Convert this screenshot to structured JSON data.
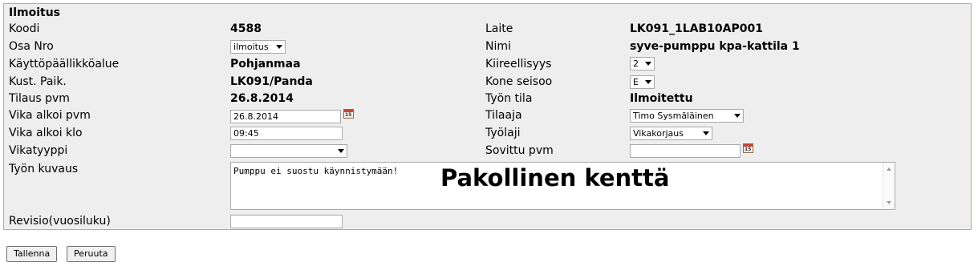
{
  "form": {
    "title": "Ilmoitus",
    "left": {
      "koodi_label": "Koodi",
      "koodi_value": "4588",
      "osa_nro_label": "Osa Nro",
      "osa_nro_value": "ilmoitus",
      "kayttopaallikkoalue_label": "Käyttöpäällikköalue",
      "kayttopaallikkoalue_value": "Pohjanmaa",
      "kust_paik_label": "Kust. Paik.",
      "kust_paik_value": "LK091/Panda",
      "tilaus_pvm_label": "Tilaus pvm",
      "tilaus_pvm_value": "26.8.2014",
      "vika_alkoi_pvm_label": "Vika alkoi pvm",
      "vika_alkoi_pvm_value": "26.8.2014",
      "vika_alkoi_klo_label": "Vika alkoi klo",
      "vika_alkoi_klo_value": "09:45",
      "vikatyyppi_label": "Vikatyyppi",
      "vikatyyppi_value": "",
      "tyon_kuvaus_label": "Työn kuvaus",
      "revisio_label": "Revisio(vuosiluku)",
      "revisio_value": ""
    },
    "right": {
      "laite_label": "Laite",
      "laite_value": "LK091_1LAB10AP001",
      "nimi_label": "Nimi",
      "nimi_value": "syve-pumppu kpa-kattila 1",
      "kiireellisyys_label": "Kiireellisyys",
      "kiireellisyys_value": "2",
      "kone_seisoo_label": "Kone seisoo",
      "kone_seisoo_value": "E",
      "tyon_tila_label": "Työn tila",
      "tyon_tila_value": "Ilmoitettu",
      "tilaaja_label": "Tilaaja",
      "tilaaja_value": "Timo Sysmäläinen",
      "tyolaji_label": "Työlaji",
      "tyolaji_value": "Vikakorjaus",
      "sovittu_pvm_label": "Sovittu pvm",
      "sovittu_pvm_value": ""
    },
    "tyon_kuvaus_text": "Pumppu ei suostu käynnistymään!",
    "annotation": "Pakollinen kenttä",
    "calendar_icon_text": "15"
  },
  "buttons": {
    "save": "Tallenna",
    "cancel": "Peruuta"
  },
  "colors": {
    "panel_bg": "#efeeee",
    "panel_border": "#d8a25a"
  }
}
